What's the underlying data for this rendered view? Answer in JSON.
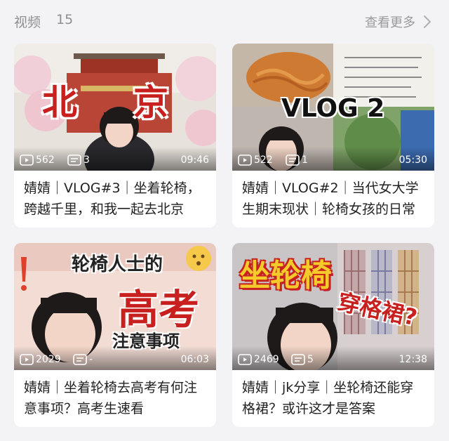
{
  "header": {
    "title": "视频",
    "count": "15",
    "see_more": "查看更多"
  },
  "videos": [
    {
      "views": "562",
      "danmaku": "3",
      "duration": "09:46",
      "title": "婧婧｜VLOG#3｜坐着轮椅，跨越千里，和我一起去北京",
      "thumb_text": [
        "北",
        "京"
      ]
    },
    {
      "views": "522",
      "danmaku": "1",
      "duration": "05:30",
      "title": "婧婧｜VLOG#2｜当代女大学生期末现状｜轮椅女孩的日常",
      "thumb_text": [
        "VLOG 2"
      ]
    },
    {
      "views": "2029",
      "danmaku": "-",
      "duration": "06:03",
      "title": "婧婧｜坐着轮椅去高考有何注意事项？高考生速看",
      "thumb_text": [
        "轮椅人士的",
        "高考",
        "注意事项"
      ]
    },
    {
      "views": "2469",
      "danmaku": "5",
      "duration": "12:38",
      "title": "婧婧｜jk分享｜坐轮椅还能穿格裙？或许这才是答案",
      "thumb_text": [
        "坐轮椅",
        "穿格裙?"
      ]
    }
  ],
  "icons": {
    "play": "play-count-icon",
    "danmaku": "danmaku-icon",
    "chevron": "chevron-right-icon"
  },
  "colors": {
    "background": "#f3f3f5",
    "card": "#ffffff",
    "muted_text": "#8e8e93",
    "title_red": "#c8201e",
    "title_yellow": "#f4cb2a"
  }
}
